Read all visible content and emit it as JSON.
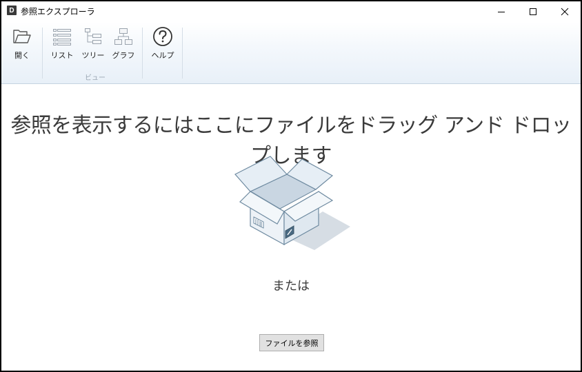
{
  "window": {
    "icon_letter": "D",
    "title": "参照エクスプローラ"
  },
  "ribbon": {
    "open_label": "開く",
    "list_label": "リスト",
    "tree_label": "ツリー",
    "graph_label": "グラフ",
    "view_group_label": "ビュー",
    "help_label": "ヘルプ"
  },
  "main": {
    "headline": "参照を表示するにはここにファイルをドラッグ アンド ドロップします",
    "or_text": "または",
    "browse_button": "ファイルを参照"
  },
  "colors": {
    "ribbon_top": "#ffffff",
    "ribbon_bottom": "#e8f0f8",
    "button_bg": "#e1e1e1",
    "text": "#3b3b3b"
  },
  "icons": [
    "folder-open-icon",
    "list-icon",
    "tree-icon",
    "graph-icon",
    "help-icon",
    "open-box-icon"
  ]
}
